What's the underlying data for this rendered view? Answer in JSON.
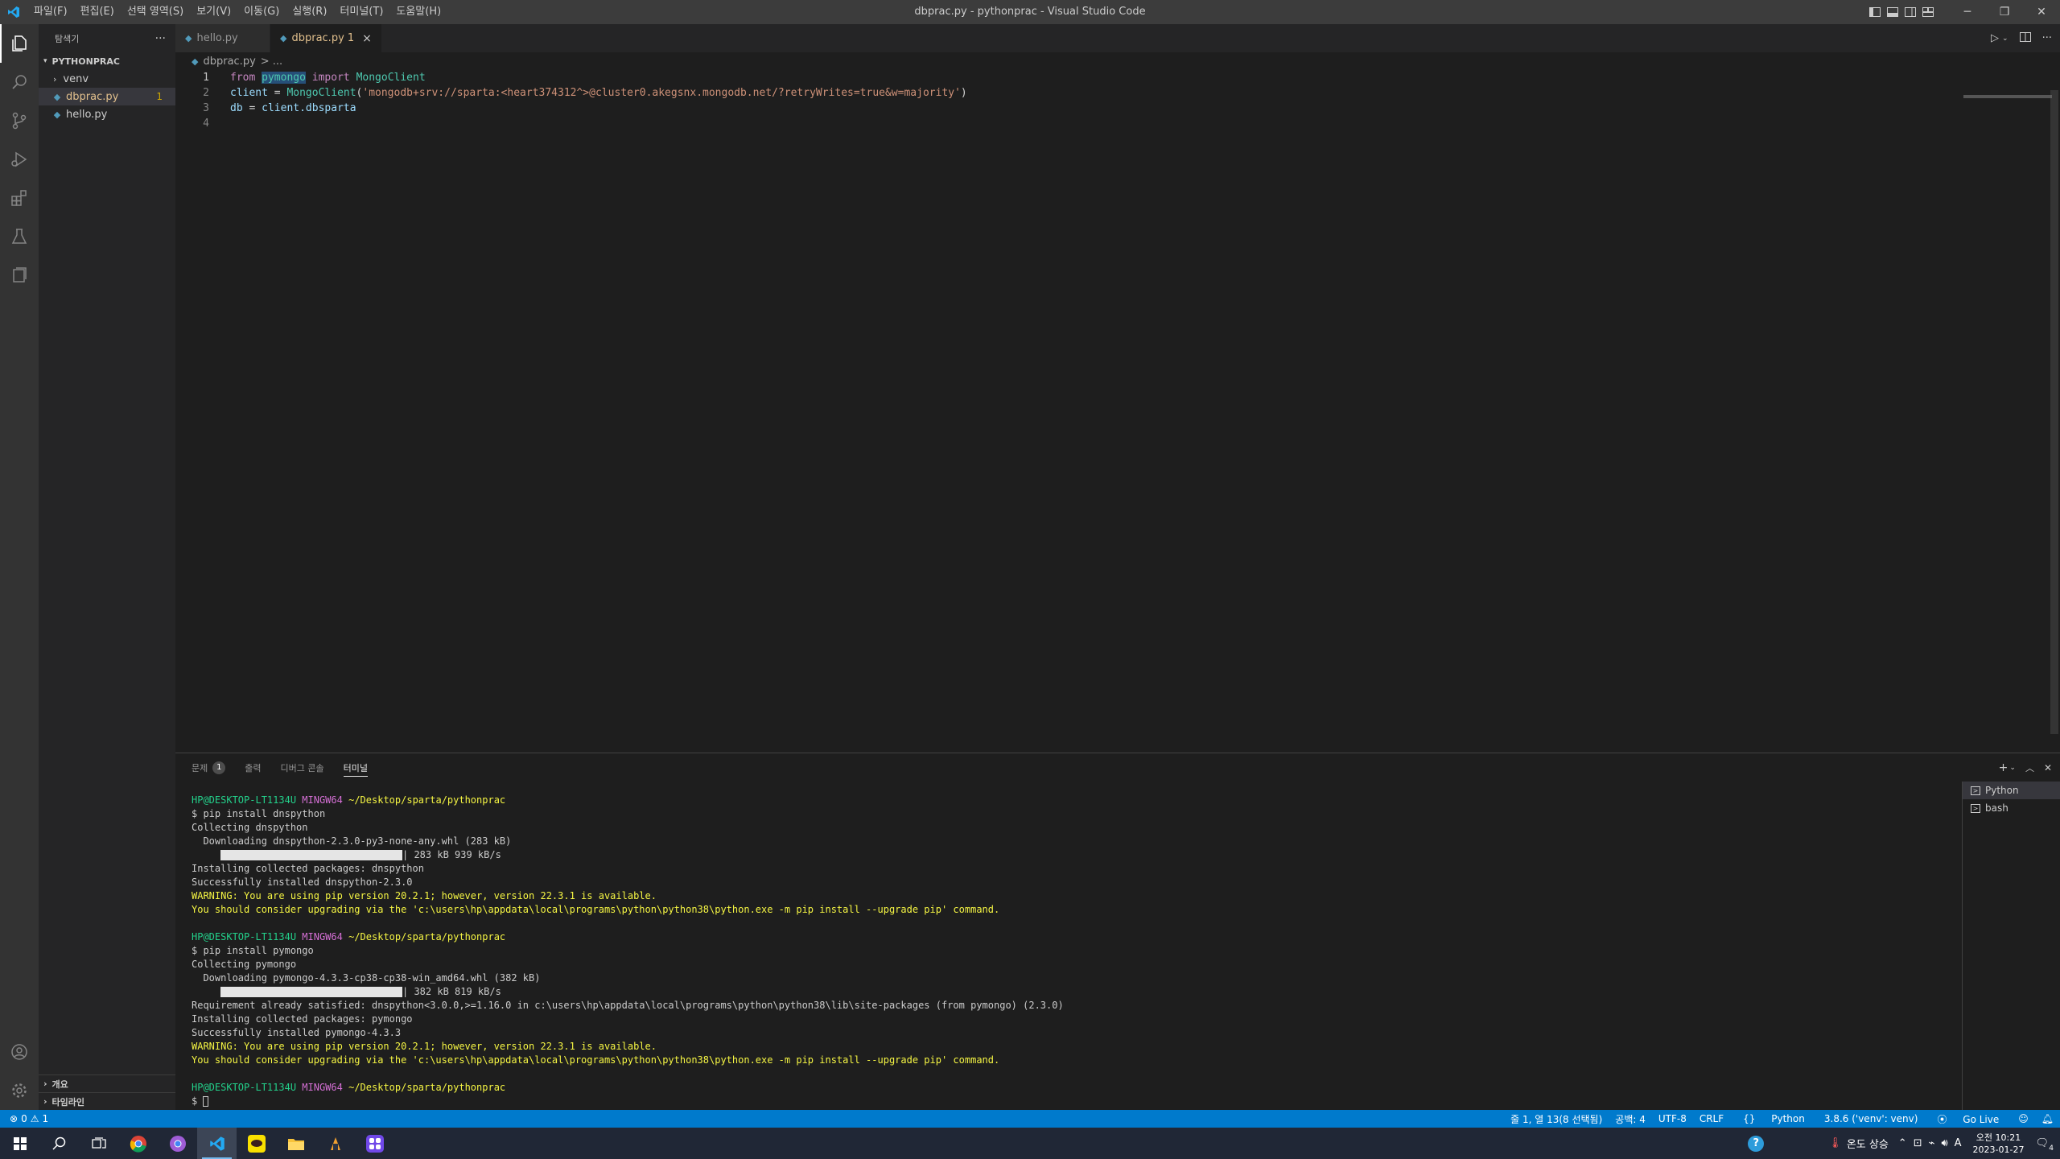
{
  "window": {
    "title": "dbprac.py - pythonprac - Visual Studio Code",
    "menu": [
      "파일(F)",
      "편집(E)",
      "선택 영역(S)",
      "보기(V)",
      "이동(G)",
      "실행(R)",
      "터미널(T)",
      "도움말(H)"
    ]
  },
  "sidebar": {
    "header": "탐색기",
    "folder": "PYTHONPRAC",
    "items": [
      {
        "label": "venv",
        "type": "folder"
      },
      {
        "label": "dbprac.py",
        "type": "file",
        "badge": "1"
      },
      {
        "label": "hello.py",
        "type": "file"
      }
    ],
    "outline": "개요",
    "timeline": "타임라인"
  },
  "editor": {
    "tabs": [
      {
        "label": "hello.py",
        "active": false
      },
      {
        "label": "dbprac.py 1",
        "active": true
      }
    ],
    "breadcrumb": {
      "file": "dbprac.py",
      "sep": "> ..."
    },
    "lines": [
      {
        "num": "1",
        "kw": "from",
        "sel": "pymongo",
        "kw2": "import",
        "cls": "MongoClient"
      },
      {
        "num": "2",
        "var": "client",
        "op": " = ",
        "cls": "MongoClient",
        "open": "(",
        "str": "'mongodb+srv://sparta:<heart374312^>@cluster0.akegsnx.mongodb.net/?retryWrites=true&w=majority'",
        "close": ")"
      },
      {
        "num": "3",
        "var": "db",
        "op": " = ",
        "obj": "client",
        "attr": ".dbsparta"
      },
      {
        "num": "4"
      }
    ]
  },
  "panel": {
    "tabs": [
      "문제",
      "출력",
      "디버그 콘솔",
      "터미널"
    ],
    "problem_count": "1",
    "terminals": [
      "Python",
      "bash"
    ],
    "prompt": {
      "user": "HP@DESKTOP-LT1134U",
      "shell": "MINGW64",
      "path": "~/Desktop/sparta/pythonprac"
    },
    "output": [
      "$ pip install dnspython",
      "Collecting dnspython",
      "  Downloading dnspython-2.3.0-py3-none-any.whl (283 kB)",
      "| 283 kB 939 kB/s",
      "Installing collected packages: dnspython",
      "Successfully installed dnspython-2.3.0",
      "WARNING: You are using pip version 20.2.1; however, version 22.3.1 is available.",
      "You should consider upgrading via the 'c:\\users\\hp\\appdata\\local\\programs\\python\\python38\\python.exe -m pip install --upgrade pip' command.",
      "$ pip install pymongo",
      "Collecting pymongo",
      "  Downloading pymongo-4.3.3-cp38-cp38-win_amd64.whl (382 kB)",
      "| 382 kB 819 kB/s",
      "Requirement already satisfied: dnspython<3.0.0,>=1.16.0 in c:\\users\\hp\\appdata\\local\\programs\\python\\python38\\lib\\site-packages (from pymongo) (2.3.0)",
      "Installing collected packages: pymongo",
      "Successfully installed pymongo-4.3.3",
      "WARNING: You are using pip version 20.2.1; however, version 22.3.1 is available.",
      "You should consider upgrading via the 'c:\\users\\hp\\appdata\\local\\programs\\python\\python38\\python.exe -m pip install --upgrade pip' command.",
      "$ "
    ]
  },
  "status": {
    "errors": "0",
    "warnings": "1",
    "position": "줄 1, 열 13(8 선택됨)",
    "spaces": "공백: 4",
    "encoding": "UTF-8",
    "eol": "CRLF",
    "language": "Python",
    "interpreter": "3.8.6 ('venv': venv)",
    "golive": "Go Live"
  },
  "taskbar": {
    "weather": "온도 상승",
    "ime": "A",
    "time": "오전 10:21",
    "date": "2023-01-27",
    "notifications": "4"
  },
  "colors": {
    "accent": "#007acc",
    "titlebar": "#3c3c3c",
    "editor_bg": "#1e1e1e",
    "modified_tab": "#e2c08d",
    "term_green": "#23d18b",
    "term_magenta": "#d670d6",
    "term_yellow": "#f5f543"
  }
}
